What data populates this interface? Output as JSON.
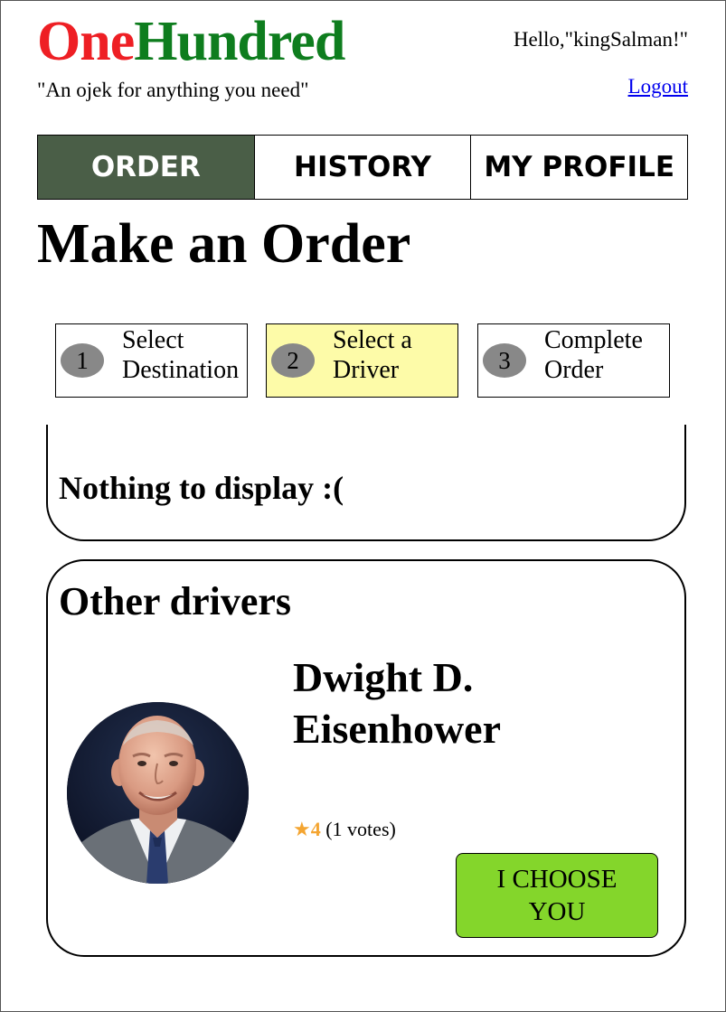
{
  "header": {
    "brand_part1": "One",
    "brand_part2": "Hundred",
    "tagline": "\"An ojek for anything you need\"",
    "greeting": "Hello,\"kingSalman!\"",
    "logout_label": "Logout"
  },
  "nav": {
    "tabs": [
      {
        "label": "ORDER",
        "active": true
      },
      {
        "label": "HISTORY",
        "active": false
      },
      {
        "label": "MY PROFILE",
        "active": false
      }
    ]
  },
  "page": {
    "title": "Make an Order"
  },
  "steps": [
    {
      "number": "1",
      "label": "Select Destination",
      "active": false
    },
    {
      "number": "2",
      "label": "Select a Driver",
      "active": true
    },
    {
      "number": "3",
      "label": "Complete Order",
      "active": false
    }
  ],
  "preferred": {
    "empty_message": "Nothing to display :("
  },
  "other_drivers": {
    "title": "Other drivers",
    "drivers": [
      {
        "name": "Dwight D. Eisenhower",
        "rating_icon": "star-icon",
        "rating": "4",
        "votes": "(1 votes)",
        "choose_label": "I CHOOSE YOU"
      }
    ]
  },
  "colors": {
    "brand_one": "#ee1f24",
    "brand_hundred": "#0e7d1e",
    "nav_active_bg": "#4a5e47",
    "step_active_bg": "#fdfba8",
    "step_number_bg": "#888888",
    "choose_button_bg": "#84d62b",
    "rating_star": "#f4a531",
    "link": "#0000ee"
  }
}
